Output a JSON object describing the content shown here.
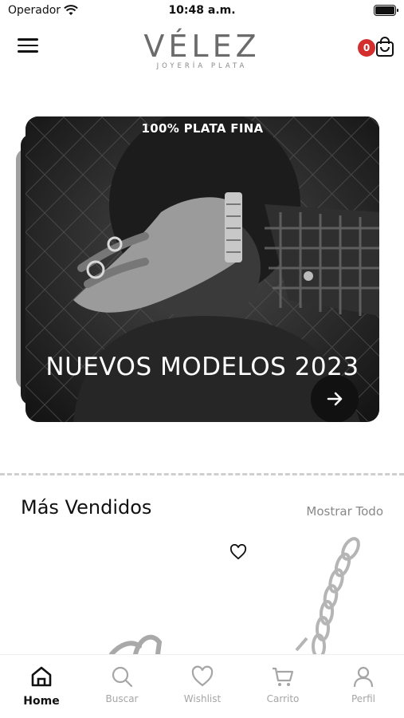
{
  "status_bar": {
    "carrier": "Operador",
    "time": "10:48 a.m."
  },
  "header": {
    "logo_main": "VÉLEZ",
    "logo_sub": "JOYERÍA PLATA",
    "cart_count": "0"
  },
  "hero": {
    "top_label": "100% PLATA FINA",
    "title": "NUEVOS MODELOS 2023"
  },
  "best_sellers": {
    "title": "Más Vendidos",
    "show_all": "Mostrar Todo"
  },
  "bottom_nav": {
    "items": [
      {
        "label": "Home",
        "icon": "home-icon",
        "active": true
      },
      {
        "label": "Buscar",
        "icon": "search-icon",
        "active": false
      },
      {
        "label": "Wishlist",
        "icon": "heart-icon",
        "active": false
      },
      {
        "label": "Carrito",
        "icon": "cart-icon",
        "active": false
      },
      {
        "label": "Perfil",
        "icon": "user-icon",
        "active": false
      }
    ]
  },
  "colors": {
    "badge": "#d32f2f",
    "logo": "#6b6b6b",
    "inactive_nav": "#a5a5a5"
  }
}
